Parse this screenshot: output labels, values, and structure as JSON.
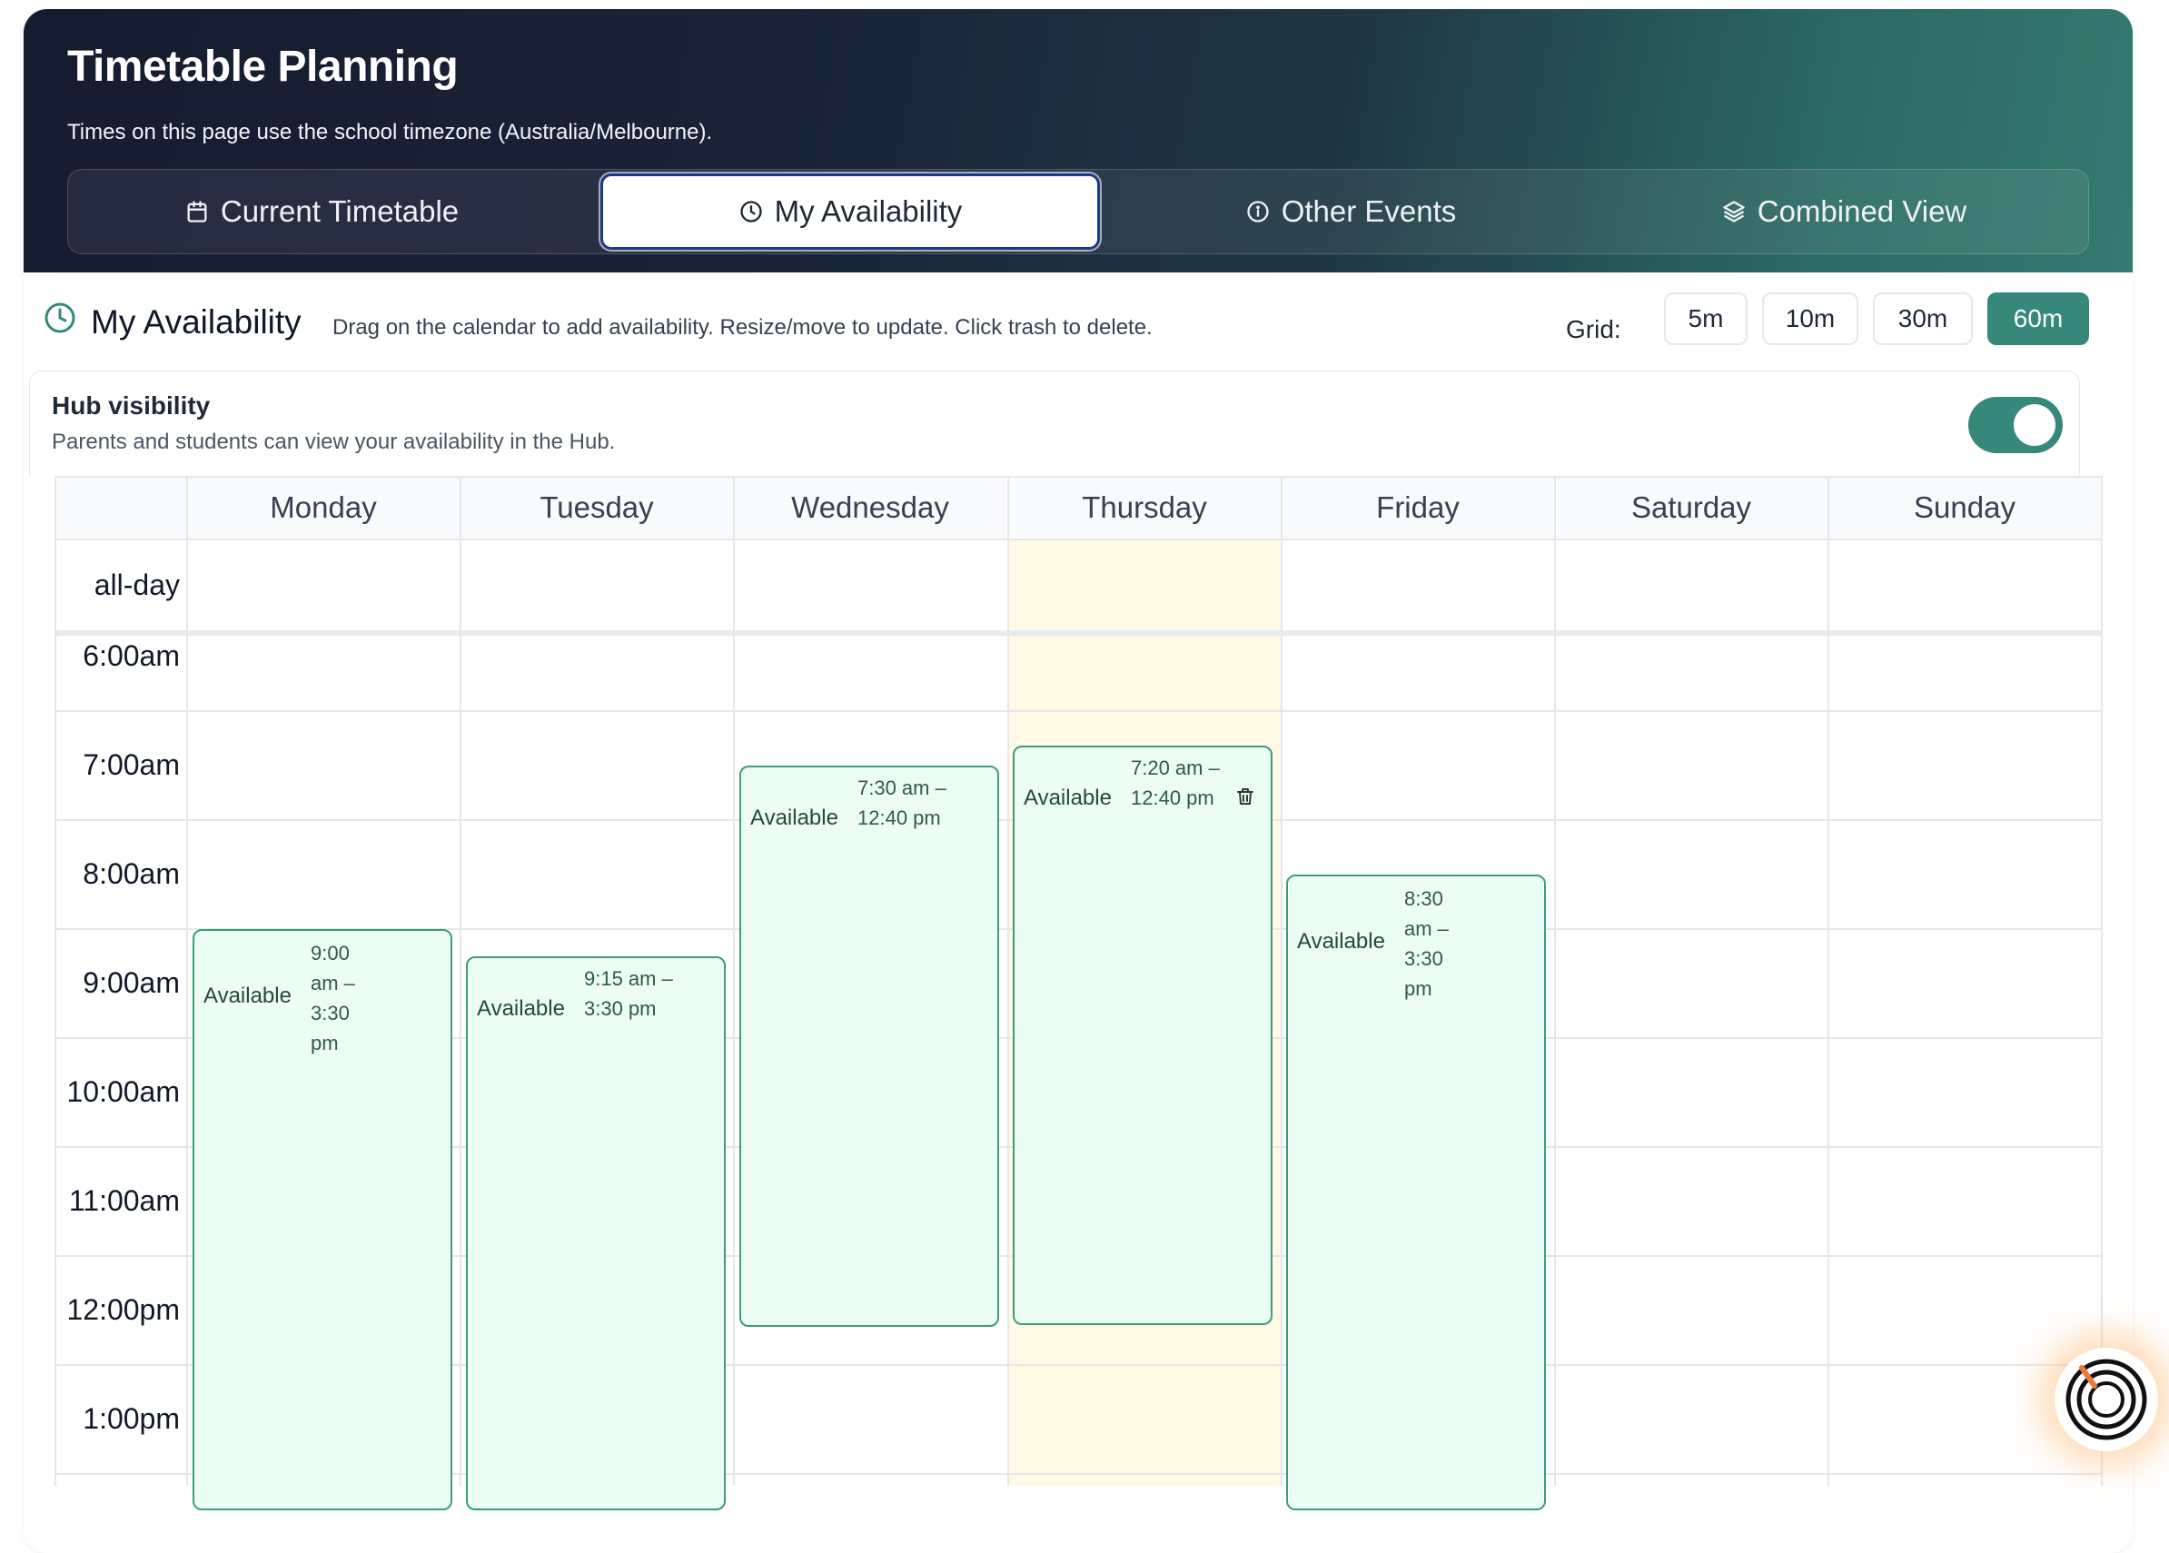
{
  "header": {
    "title": "Timetable Planning",
    "subtitle": "Times on this page use the school timezone (Australia/Melbourne).",
    "tabs": [
      {
        "label": "Current Timetable",
        "icon": "calendar-icon"
      },
      {
        "label": "My Availability",
        "icon": "clock-icon",
        "active": true
      },
      {
        "label": "Other Events",
        "icon": "info-icon"
      },
      {
        "label": "Combined View",
        "icon": "layers-icon"
      }
    ]
  },
  "section": {
    "title": "My Availability",
    "description": "Drag on the calendar to add availability. Resize/move to update. Click trash to delete.",
    "grid_label": "Grid:",
    "grid_options": [
      "5m",
      "10m",
      "30m",
      "60m"
    ],
    "grid_selected": "60m"
  },
  "hub": {
    "title": "Hub visibility",
    "description": "Parents and students can view your availability in the Hub.",
    "enabled": true
  },
  "calendar": {
    "days": [
      "Monday",
      "Tuesday",
      "Wednesday",
      "Thursday",
      "Friday",
      "Saturday",
      "Sunday"
    ],
    "highlighted_day": "Thursday",
    "all_day_label": "all-day",
    "times": [
      "6:00am",
      "7:00am",
      "8:00am",
      "9:00am",
      "10:00am",
      "11:00am",
      "12:00pm",
      "1:00pm"
    ],
    "events": [
      {
        "label": "Available",
        "time": "9:00 am – 3:30 pm"
      },
      {
        "label": "Available",
        "time": "9:15 am – 3:30 pm"
      },
      {
        "label": "Available",
        "time": "7:30 am – 12:40 pm"
      },
      {
        "label": "Available",
        "time": "7:20 am – 12:40 pm"
      },
      {
        "label": "Available",
        "time": "8:30 am – 3:30 pm"
      }
    ]
  },
  "colors": {
    "accent": "#35887a",
    "event_bg": "#ecfdf3",
    "event_border": "#3f9b7f",
    "today_bg": "#fefae6",
    "header_start": "#151c30",
    "header_end": "#347a70"
  }
}
